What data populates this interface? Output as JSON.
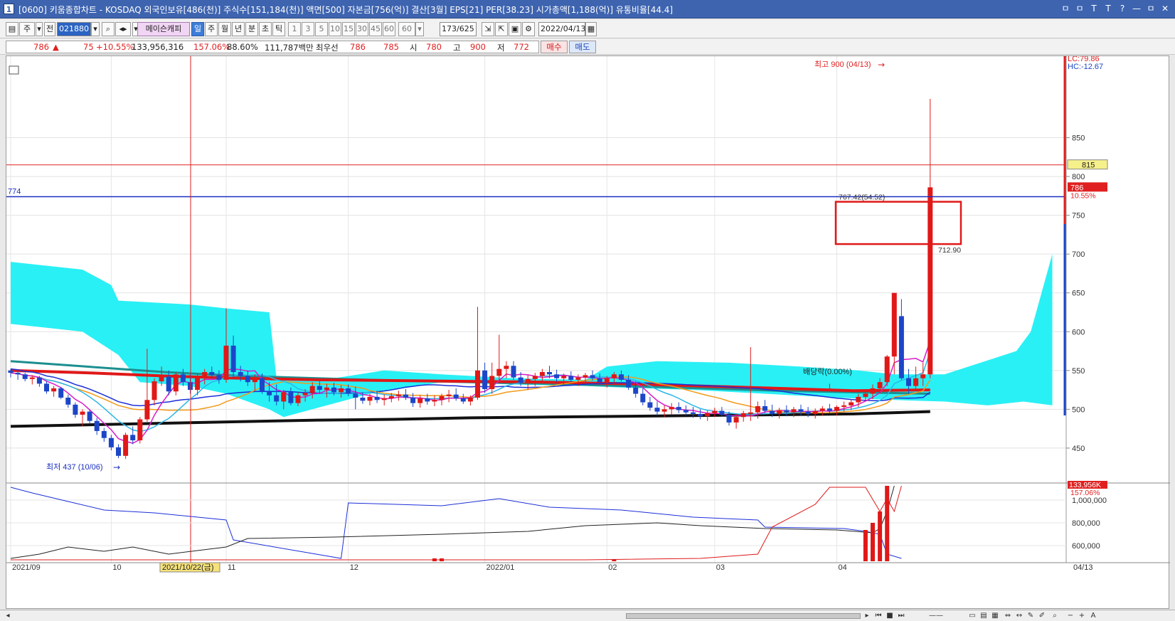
{
  "window": {
    "app_number": "1",
    "title": "[0600] 키움종합차트 - KOSDAQ 외국인보유[486(천)] 주식수[151,184(천)] 액면[500] 자본금[756(억)] 결산[3월] EPS[21] PER[38.23] 시가총액[1,188(억)] 유통비율[44.4]",
    "buttons": [
      "ㅁ",
      "ㅁ",
      "T",
      "T",
      "?",
      "—",
      "ㅁ",
      "✕"
    ]
  },
  "toolbar": {
    "chart_type": "주",
    "code_prefix": "전",
    "stock_code": "021880",
    "company_button": "메이슨캐피",
    "periods": [
      "일",
      "주",
      "월",
      "년",
      "분",
      "초",
      "틱"
    ],
    "selected_period": "일",
    "intervals": [
      "1",
      "3",
      "5",
      "10",
      "15",
      "30",
      "45",
      "60",
      "60"
    ],
    "count": "173/625",
    "date": "2022/04/13"
  },
  "quote": {
    "price": "786",
    "change": "75",
    "change_pct": "+10.55%",
    "volume": "133,956,316",
    "vol_ratio": "157.06%",
    "turnover": "88.60%",
    "amount": "111,787백만",
    "best_label": "최우선",
    "best_ask": "786",
    "best_bid": "785",
    "open_label": "시",
    "open": "780",
    "high_label": "고",
    "high": "900",
    "low_label": "저",
    "low": "772",
    "buy_label": "매수",
    "sell_label": "매도"
  },
  "chart_data": {
    "type": "candlestick",
    "series": [
      {
        "name": "price",
        "unit": "KRW"
      }
    ],
    "y_ticks": [
      450,
      500,
      550,
      600,
      650,
      700,
      750,
      800,
      850
    ],
    "ylim": [
      405,
      955
    ],
    "x_tick_labels": [
      "2021/09",
      "10",
      "11",
      "12",
      "2022/01",
      "02",
      "03",
      "04",
      "04/13"
    ],
    "crosshair_date": "2021/10/22(금)",
    "high_note": "최고 900 (04/13)",
    "low_note": "최저 437 (10/06)",
    "horizontal_lines": [
      {
        "value": 774,
        "label": "774"
      },
      {
        "value": 815,
        "label": "815"
      }
    ],
    "current_price": "786",
    "current_pct": "10.55%",
    "lc": "LC:79.86",
    "hc": "HC:-12.67",
    "box_top_label": "767.42(54.52)",
    "box_bottom_label": "712.90",
    "dividend_label": "배당락(0.00%)",
    "volume_panel": {
      "y_ticks": [
        "1,000,000",
        "800,000",
        "600,000"
      ],
      "last_volume": "133,956K",
      "last_pct": "157.06%"
    },
    "candles": [
      [
        550,
        552,
        541,
        547
      ],
      [
        547,
        549,
        538,
        545
      ],
      [
        545,
        547,
        536,
        539
      ],
      [
        539,
        544,
        532,
        541
      ],
      [
        541,
        543,
        529,
        533
      ],
      [
        533,
        536,
        520,
        523
      ],
      [
        523,
        530,
        516,
        527
      ],
      [
        527,
        529,
        513,
        515
      ],
      [
        515,
        519,
        502,
        506
      ],
      [
        506,
        509,
        489,
        493
      ],
      [
        493,
        500,
        478,
        497
      ],
      [
        497,
        499,
        482,
        485
      ],
      [
        485,
        489,
        467,
        472
      ],
      [
        472,
        476,
        458,
        463
      ],
      [
        463,
        467,
        447,
        451
      ],
      [
        451,
        455,
        437,
        440
      ],
      [
        440,
        470,
        436,
        467
      ],
      [
        467,
        478,
        455,
        460
      ],
      [
        460,
        490,
        456,
        487
      ],
      [
        487,
        578,
        484,
        512
      ],
      [
        512,
        540,
        505,
        536
      ],
      [
        536,
        555,
        530,
        542
      ],
      [
        542,
        550,
        518,
        523
      ],
      [
        523,
        548,
        518,
        545
      ],
      [
        545,
        552,
        530,
        535
      ],
      [
        535,
        545,
        520,
        525
      ],
      [
        525,
        545,
        518,
        540
      ],
      [
        540,
        552,
        532,
        548
      ],
      [
        548,
        555,
        540,
        544
      ],
      [
        544,
        550,
        533,
        538
      ],
      [
        538,
        630,
        534,
        582
      ],
      [
        582,
        595,
        540,
        548
      ],
      [
        548,
        556,
        536,
        543
      ],
      [
        543,
        550,
        530,
        535
      ],
      [
        535,
        545,
        524,
        540
      ],
      [
        540,
        546,
        520,
        523
      ],
      [
        523,
        535,
        510,
        518
      ],
      [
        518,
        532,
        505,
        510
      ],
      [
        510,
        525,
        500,
        522
      ],
      [
        522,
        528,
        505,
        508
      ],
      [
        508,
        522,
        504,
        518
      ],
      [
        518,
        526,
        510,
        521
      ],
      [
        521,
        535,
        514,
        530
      ],
      [
        530,
        536,
        520,
        525
      ],
      [
        525,
        533,
        515,
        528
      ],
      [
        528,
        534,
        518,
        522
      ],
      [
        522,
        531,
        515,
        527
      ],
      [
        527,
        532,
        517,
        520
      ],
      [
        520,
        529,
        500,
        515
      ],
      [
        515,
        522,
        507,
        511
      ],
      [
        511,
        520,
        505,
        516
      ],
      [
        516,
        524,
        508,
        512
      ],
      [
        512,
        519,
        505,
        514
      ],
      [
        514,
        521,
        509,
        517
      ],
      [
        517,
        524,
        511,
        519
      ],
      [
        519,
        526,
        512,
        515
      ],
      [
        515,
        521,
        503,
        508
      ],
      [
        508,
        518,
        502,
        514
      ],
      [
        514,
        520,
        506,
        510
      ],
      [
        510,
        518,
        504,
        512
      ],
      [
        512,
        520,
        505,
        517
      ],
      [
        517,
        525,
        509,
        519
      ],
      [
        519,
        527,
        511,
        514
      ],
      [
        514,
        520,
        507,
        510
      ],
      [
        510,
        518,
        505,
        515
      ],
      [
        515,
        632,
        512,
        550
      ],
      [
        550,
        560,
        521,
        526
      ],
      [
        526,
        560,
        520,
        543
      ],
      [
        543,
        596,
        536,
        552
      ],
      [
        552,
        562,
        540,
        556
      ],
      [
        556,
        562,
        538,
        541
      ],
      [
        541,
        548,
        530,
        534
      ],
      [
        534,
        544,
        525,
        539
      ],
      [
        539,
        547,
        530,
        543
      ],
      [
        543,
        552,
        535,
        548
      ],
      [
        548,
        556,
        540,
        545
      ],
      [
        545,
        551,
        535,
        540
      ],
      [
        540,
        546,
        530,
        543
      ],
      [
        543,
        549,
        535,
        538
      ],
      [
        538,
        545,
        530,
        541
      ],
      [
        541,
        547,
        533,
        544
      ],
      [
        544,
        550,
        537,
        540
      ],
      [
        540,
        546,
        532,
        535
      ],
      [
        535,
        543,
        528,
        540
      ],
      [
        540,
        548,
        533,
        545
      ],
      [
        545,
        550,
        536,
        538
      ],
      [
        538,
        544,
        525,
        528
      ],
      [
        528,
        536,
        515,
        520
      ],
      [
        520,
        527,
        505,
        509
      ],
      [
        509,
        516,
        498,
        502
      ],
      [
        502,
        510,
        492,
        497
      ],
      [
        497,
        505,
        490,
        500
      ],
      [
        500,
        508,
        493,
        503
      ],
      [
        503,
        509,
        495,
        499
      ],
      [
        499,
        505,
        492,
        496
      ],
      [
        496,
        503,
        489,
        494
      ],
      [
        494,
        500,
        487,
        491
      ],
      [
        491,
        498,
        485,
        495
      ],
      [
        495,
        502,
        490,
        498
      ],
      [
        498,
        503,
        491,
        493
      ],
      [
        493,
        497,
        479,
        483
      ],
      [
        483,
        494,
        475,
        490
      ],
      [
        490,
        498,
        484,
        495
      ],
      [
        495,
        580,
        485,
        496
      ],
      [
        496,
        510,
        488,
        504
      ],
      [
        504,
        512,
        495,
        498
      ],
      [
        498,
        506,
        490,
        494
      ],
      [
        494,
        502,
        488,
        499
      ],
      [
        499,
        505,
        491,
        496
      ],
      [
        496,
        503,
        490,
        500
      ],
      [
        500,
        506,
        492,
        497
      ],
      [
        497,
        503,
        490,
        494
      ],
      [
        494,
        501,
        488,
        498
      ],
      [
        498,
        504,
        492,
        501
      ],
      [
        501,
        507,
        495,
        498
      ],
      [
        498,
        505,
        492,
        503
      ],
      [
        503,
        510,
        497,
        505
      ],
      [
        505,
        512,
        499,
        509
      ],
      [
        509,
        520,
        503,
        516
      ],
      [
        516,
        524,
        510,
        520
      ],
      [
        520,
        532,
        513,
        527
      ],
      [
        527,
        540,
        520,
        535
      ],
      [
        535,
        570,
        530,
        568
      ],
      [
        568,
        642,
        545,
        650
      ],
      [
        620,
        642,
        538,
        540
      ],
      [
        540,
        552,
        520,
        530
      ],
      [
        530,
        555,
        525,
        540
      ],
      [
        540,
        560,
        530,
        545
      ],
      [
        545,
        900,
        540,
        786
      ]
    ]
  }
}
